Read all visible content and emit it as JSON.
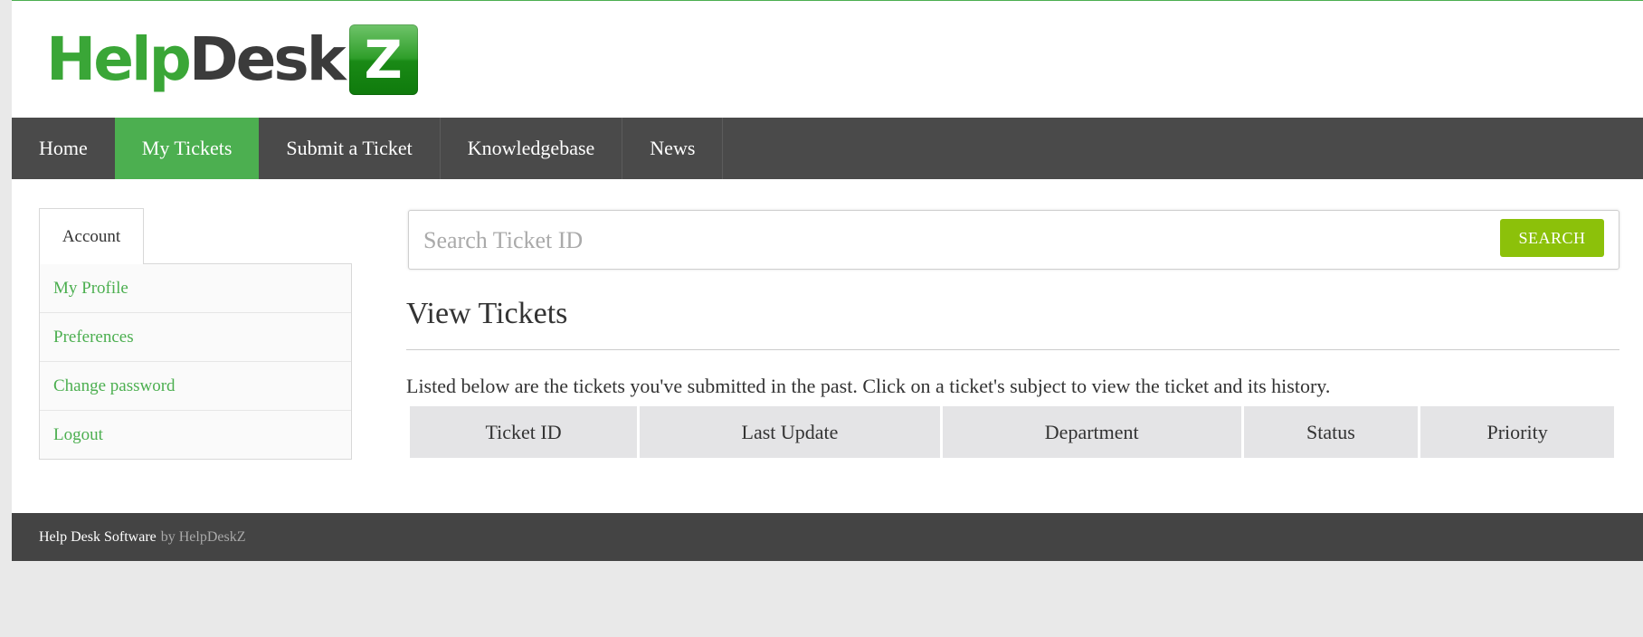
{
  "logo": {
    "help": "Help",
    "desk": "Desk",
    "z": "Z"
  },
  "nav": {
    "items": [
      {
        "label": "Home"
      },
      {
        "label": "My Tickets"
      },
      {
        "label": "Submit a Ticket"
      },
      {
        "label": "Knowledgebase"
      },
      {
        "label": "News"
      }
    ],
    "active": "My Tickets"
  },
  "sidebar": {
    "tab": "Account",
    "items": [
      {
        "label": "My Profile"
      },
      {
        "label": "Preferences"
      },
      {
        "label": "Change password"
      },
      {
        "label": "Logout"
      }
    ]
  },
  "search": {
    "placeholder": "Search Ticket ID",
    "button": "SEARCH"
  },
  "main": {
    "title": "View Tickets",
    "intro": "Listed below are the tickets you've submitted in the past. Click on a ticket's subject to view the ticket and its history.",
    "columns": [
      "Ticket ID",
      "Last Update",
      "Department",
      "Status",
      "Priority"
    ]
  },
  "footer": {
    "link": "Help Desk Software",
    "by": "by HelpDeskZ"
  },
  "colors": {
    "accent": "#4caf50",
    "nav_bg": "#4a4a4a",
    "search_button": "#8cc10a",
    "footer_bg": "#444444"
  }
}
